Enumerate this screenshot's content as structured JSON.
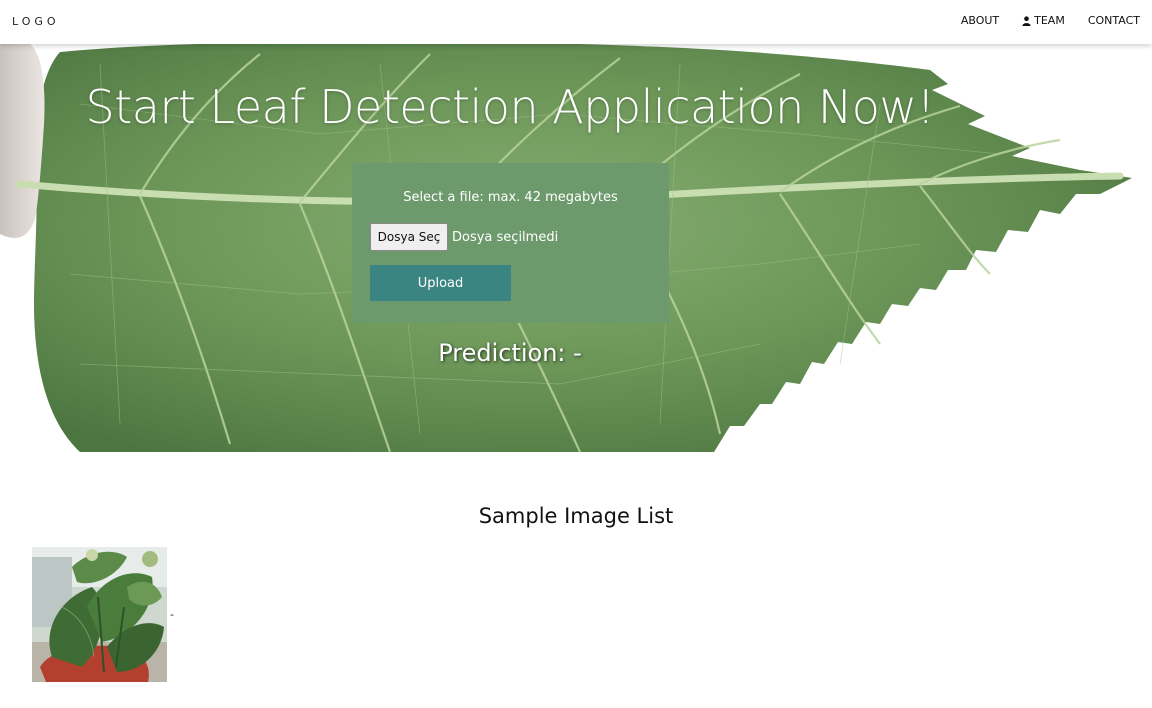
{
  "nav": {
    "logo": "LOGO",
    "links": [
      {
        "label": "ABOUT"
      },
      {
        "label": "TEAM",
        "icon": "user-icon"
      },
      {
        "label": "CONTACT"
      }
    ]
  },
  "hero": {
    "title": "Start Leaf Detection Application Now!",
    "upload": {
      "hint": "Select a file: max. 42 megabytes",
      "file_button": "Dosya Seç",
      "file_status": "Dosya seçilmedi",
      "submit_label": "Upload"
    },
    "prediction": "Prediction: -"
  },
  "samples": {
    "title": "Sample Image List",
    "items": [
      {
        "label": "-",
        "image": "chili-plant-leaves-photo"
      }
    ]
  },
  "colors": {
    "upload_box_bg": "#6d9a6c",
    "upload_button_bg": "#3a8582",
    "leaf_green": "#6f9a5a"
  }
}
